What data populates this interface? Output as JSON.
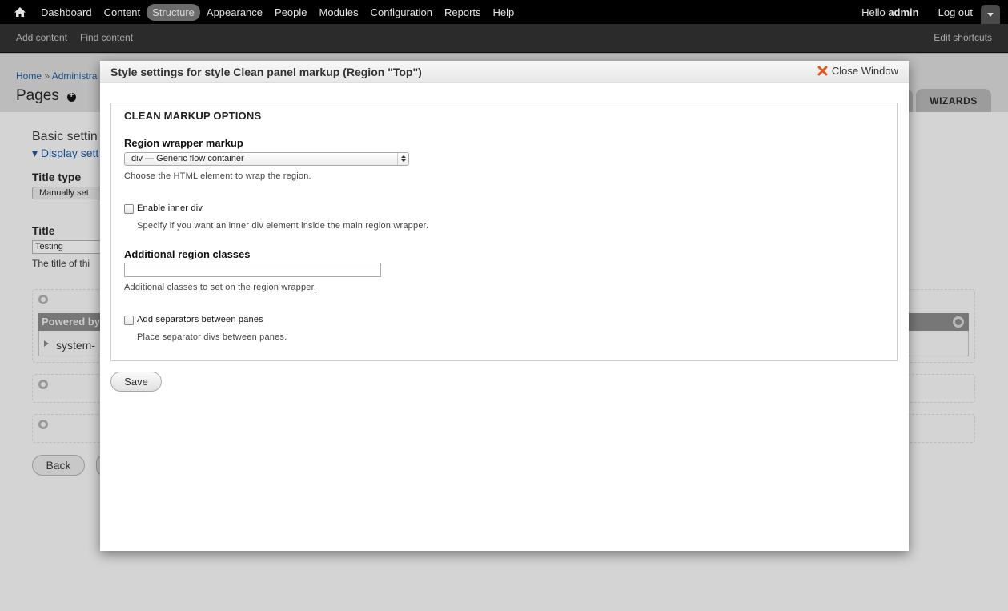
{
  "toolbar": {
    "nav": [
      "Dashboard",
      "Content",
      "Structure",
      "Appearance",
      "People",
      "Modules",
      "Configuration",
      "Reports",
      "Help"
    ],
    "active": "Structure",
    "hello_prefix": "Hello ",
    "user": "admin",
    "logout": "Log out"
  },
  "shortcuts": {
    "add_content": "Add content",
    "find_content": "Find content",
    "edit_shortcuts": "Edit shortcuts"
  },
  "page": {
    "breadcrumb_home": "Home",
    "breadcrumb_sep": " » ",
    "breadcrumb_admin": "Administra",
    "title": "Pages",
    "tab_wizards": "WIZARDS",
    "basic_settings": "Basic settin",
    "display_link": "▾ Display sett",
    "title_type_label": "Title type",
    "title_type_value": "Manually set",
    "title_label": "Title",
    "title_value": "Testing",
    "title_desc": "The title of thi",
    "pane_title": "Powered by",
    "pane_content": "system-",
    "back_button": "Back"
  },
  "modal": {
    "title": "Style settings for style Clean panel markup (Region \"Top\")",
    "close_label": "Close Window",
    "legend": "CLEAN MARKUP OPTIONS",
    "wrapper_label": "Region wrapper markup",
    "wrapper_value": "div — Generic flow container",
    "wrapper_desc": "Choose the HTML element to wrap the region.",
    "inner_div_label": "Enable inner div",
    "inner_div_desc": "Specify if you want an inner div element inside the main region wrapper.",
    "classes_label": "Additional region classes",
    "classes_value": "",
    "classes_desc": "Additional classes to set on the region wrapper.",
    "separators_label": "Add separators between panes",
    "separators_desc": "Place separator divs between panes.",
    "save_label": "Save"
  },
  "colors": {
    "toolbar_bg": "#000000",
    "shortcuts_bg": "#2b2b2b",
    "active_pill": "#6b6b6b",
    "close_icon": "#e8531c",
    "link": "#184d8c"
  }
}
